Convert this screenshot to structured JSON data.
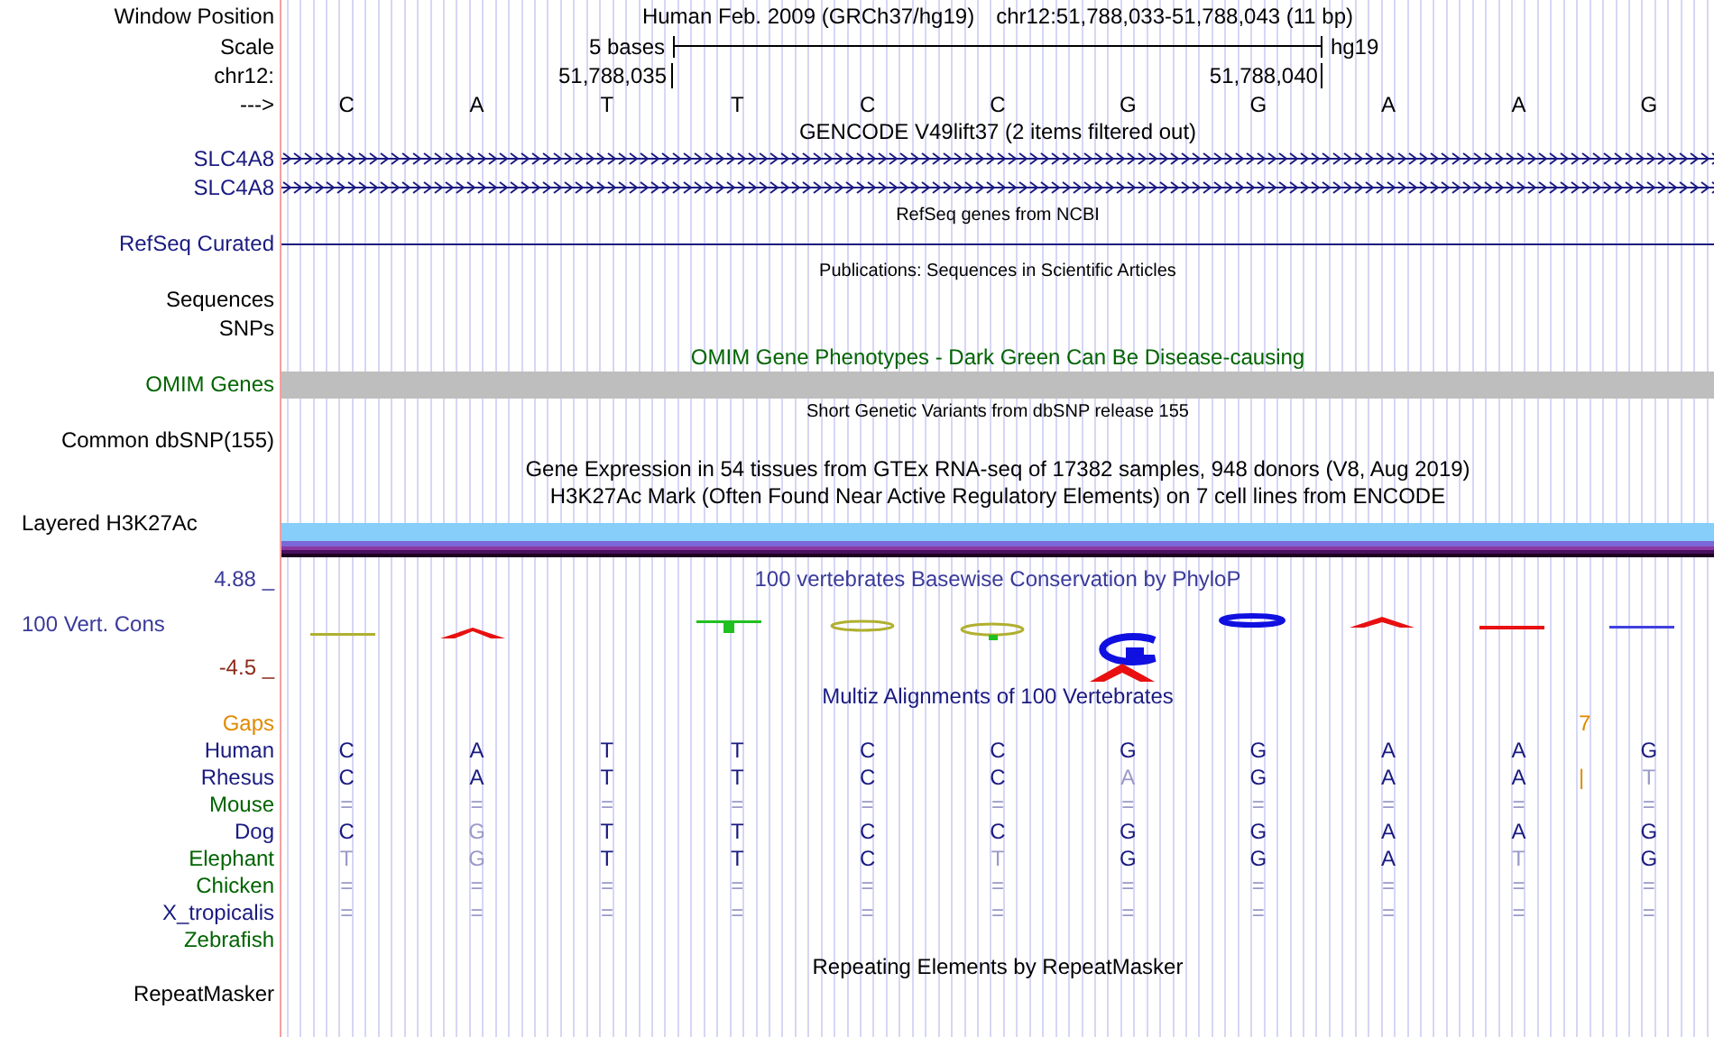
{
  "ruler": {
    "window_position_label": "Window Position",
    "assembly": "Human Feb. 2009 (GRCh37/hg19)",
    "position": "chr12:51,788,033-51,788,043 (11 bp)",
    "scale_label": "Scale",
    "scale_text": "5 bases",
    "scale_db": "hg19",
    "chrom_label": "chr12:",
    "ticks": [
      "51,788,035",
      "51,788,040"
    ],
    "strand_label": "--->",
    "bases": [
      "C",
      "A",
      "T",
      "T",
      "C",
      "C",
      "G",
      "G",
      "A",
      "A",
      "G"
    ]
  },
  "tracks": [
    {
      "kind": "title",
      "text": "GENCODE V49lift37 (2 items filtered out)",
      "color": "#000000"
    },
    {
      "kind": "gene",
      "label": "SLC4A8",
      "color": "#1a1a80"
    },
    {
      "kind": "gene",
      "label": "SLC4A8",
      "color": "#1a1a80"
    },
    {
      "kind": "caption",
      "text": "RefSeq genes from NCBI"
    },
    {
      "kind": "line",
      "label": "RefSeq Curated",
      "color": "#1a1a80"
    },
    {
      "kind": "caption",
      "text": "Publications: Sequences in Scientific Articles"
    },
    {
      "kind": "label",
      "label": "Sequences",
      "color": "#000000"
    },
    {
      "kind": "label",
      "label": "SNPs",
      "color": "#000000"
    },
    {
      "kind": "title",
      "text": "OMIM Gene Phenotypes - Dark Green Can Be Disease-causing",
      "color": "#006400"
    },
    {
      "kind": "bar",
      "label": "OMIM Genes",
      "color": "#006400"
    },
    {
      "kind": "caption",
      "text": "Short Genetic Variants from dbSNP release 155"
    },
    {
      "kind": "label",
      "label": "Common dbSNP(155)",
      "color": "#000000"
    },
    {
      "kind": "title",
      "text": "Gene Expression in 54 tissues from GTEx RNA-seq of 17382 samples, 948 donors (V8, Aug 2019)",
      "color": "#000000"
    },
    {
      "kind": "title",
      "text": "H3K27Ac Mark (Often Found Near Active Regulatory Elements) on 7 cell lines from ENCODE",
      "color": "#000000"
    },
    {
      "kind": "layered",
      "label": "Layered H3K27Ac",
      "color": "#000000"
    },
    {
      "kind": "wiggle",
      "title": "100 vertebrates Basewise Conservation by PhyloP",
      "label": "100 Vert. Cons",
      "max": "4.88 _",
      "min": "-4.5 _",
      "color": "#3a3a9a"
    },
    {
      "kind": "title",
      "text": "Multiz Alignments of 100 Vertebrates",
      "color": "#1a1a80"
    },
    {
      "kind": "alignment",
      "label": "Gaps",
      "color": "#e08a00",
      "gap": "7"
    },
    {
      "kind": "alignment",
      "label": "Human",
      "color": "#1a1a80",
      "cells": [
        {
          "base": "C",
          "faint": false
        },
        {
          "base": "A",
          "faint": false
        },
        {
          "base": "T",
          "faint": false
        },
        {
          "base": "T",
          "faint": false
        },
        {
          "base": "C",
          "faint": false
        },
        {
          "base": "C",
          "faint": false
        },
        {
          "base": "G",
          "faint": false
        },
        {
          "base": "G",
          "faint": false
        },
        {
          "base": "A",
          "faint": false
        },
        {
          "base": "A",
          "faint": false
        },
        {
          "base": "G",
          "faint": false
        }
      ]
    },
    {
      "kind": "alignment",
      "label": "Rhesus",
      "color": "#1a1a80",
      "gap": "|",
      "cells": [
        {
          "base": "C",
          "faint": false
        },
        {
          "base": "A",
          "faint": false
        },
        {
          "base": "T",
          "faint": false
        },
        {
          "base": "T",
          "faint": false
        },
        {
          "base": "C",
          "faint": false
        },
        {
          "base": "C",
          "faint": false
        },
        {
          "base": "A",
          "faint": true
        },
        {
          "base": "G",
          "faint": false
        },
        {
          "base": "A",
          "faint": false
        },
        {
          "base": "A",
          "faint": false
        },
        {
          "base": "T",
          "faint": true
        }
      ]
    },
    {
      "kind": "alignment",
      "label": "Mouse",
      "color": "#006400",
      "cells": [
        {
          "base": "=",
          "faint": true
        },
        {
          "base": "=",
          "faint": true
        },
        {
          "base": "=",
          "faint": true
        },
        {
          "base": "=",
          "faint": true
        },
        {
          "base": "=",
          "faint": true
        },
        {
          "base": "=",
          "faint": true
        },
        {
          "base": "=",
          "faint": true
        },
        {
          "base": "=",
          "faint": true
        },
        {
          "base": "=",
          "faint": true
        },
        {
          "base": "=",
          "faint": true
        },
        {
          "base": "=",
          "faint": true
        }
      ]
    },
    {
      "kind": "alignment",
      "label": "Dog",
      "color": "#1a1a80",
      "cells": [
        {
          "base": "C",
          "faint": false
        },
        {
          "base": "G",
          "faint": true
        },
        {
          "base": "T",
          "faint": false
        },
        {
          "base": "T",
          "faint": false
        },
        {
          "base": "C",
          "faint": false
        },
        {
          "base": "C",
          "faint": false
        },
        {
          "base": "G",
          "faint": false
        },
        {
          "base": "G",
          "faint": false
        },
        {
          "base": "A",
          "faint": false
        },
        {
          "base": "A",
          "faint": false
        },
        {
          "base": "G",
          "faint": false
        }
      ]
    },
    {
      "kind": "alignment",
      "label": "Elephant",
      "color": "#006400",
      "cells": [
        {
          "base": "T",
          "faint": true
        },
        {
          "base": "G",
          "faint": true
        },
        {
          "base": "T",
          "faint": false
        },
        {
          "base": "T",
          "faint": false
        },
        {
          "base": "C",
          "faint": false
        },
        {
          "base": "T",
          "faint": true
        },
        {
          "base": "G",
          "faint": false
        },
        {
          "base": "G",
          "faint": false
        },
        {
          "base": "A",
          "faint": false
        },
        {
          "base": "T",
          "faint": true
        },
        {
          "base": "G",
          "faint": false
        }
      ]
    },
    {
      "kind": "alignment",
      "label": "Chicken",
      "color": "#006400",
      "cells": [
        {
          "base": "=",
          "faint": true
        },
        {
          "base": "=",
          "faint": true
        },
        {
          "base": "=",
          "faint": true
        },
        {
          "base": "=",
          "faint": true
        },
        {
          "base": "=",
          "faint": true
        },
        {
          "base": "=",
          "faint": true
        },
        {
          "base": "=",
          "faint": true
        },
        {
          "base": "=",
          "faint": true
        },
        {
          "base": "=",
          "faint": true
        },
        {
          "base": "=",
          "faint": true
        },
        {
          "base": "=",
          "faint": true
        }
      ]
    },
    {
      "kind": "alignment",
      "label": "X_tropicalis",
      "color": "#1a1a80",
      "cells": [
        {
          "base": "=",
          "faint": true
        },
        {
          "base": "=",
          "faint": true
        },
        {
          "base": "=",
          "faint": true
        },
        {
          "base": "=",
          "faint": true
        },
        {
          "base": "=",
          "faint": true
        },
        {
          "base": "=",
          "faint": true
        },
        {
          "base": "=",
          "faint": true
        },
        {
          "base": "=",
          "faint": true
        },
        {
          "base": "=",
          "faint": true
        },
        {
          "base": "=",
          "faint": true
        },
        {
          "base": "=",
          "faint": true
        }
      ]
    },
    {
      "kind": "alignment",
      "label": "Zebrafish",
      "color": "#006400"
    },
    {
      "kind": "title",
      "text": "Repeating Elements by RepeatMasker",
      "color": "#000000"
    },
    {
      "kind": "label",
      "label": "RepeatMasker",
      "color": "#000000"
    }
  ]
}
